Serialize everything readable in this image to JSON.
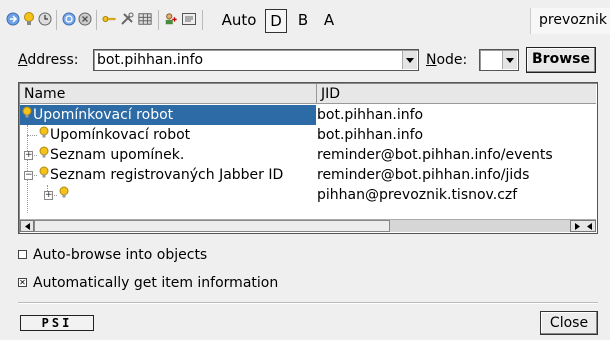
{
  "toolbar": {
    "icons": [
      "arrow-icon",
      "bulb-icon",
      "clock-icon",
      "refresh-icon",
      "stop-icon",
      "key-icon",
      "tools-icon",
      "grid-icon",
      "user-add-icon",
      "card-icon"
    ],
    "buttons": [
      {
        "label": "Auto",
        "active": false
      },
      {
        "label": "D",
        "active": true
      },
      {
        "label": "B",
        "active": false
      },
      {
        "label": "A",
        "active": false
      }
    ],
    "field_value": "prevoznik"
  },
  "address": {
    "label_u": "A",
    "label_rest": "ddress:",
    "value": "bot.pihhan.info",
    "node_label_u": "N",
    "node_label_rest": "ode:",
    "node_value": "",
    "browse_label": "Browse"
  },
  "tree": {
    "columns": [
      "Name",
      "JID"
    ],
    "rows": [
      {
        "name": "Upomínkovací robot",
        "jid": "bot.pihhan.info",
        "selected": true
      },
      {
        "name": "Upomínkovací robot",
        "jid": "bot.pihhan.info",
        "selected": false
      },
      {
        "name": "Seznam upomínek.",
        "jid": "reminder@bot.pihhan.info/events",
        "selected": false
      },
      {
        "name": "Seznam registrovaných Jabber ID",
        "jid": "reminder@bot.pihhan.info/jids",
        "selected": false
      },
      {
        "name": "",
        "jid": "pihhan@prevoznik.tisnov.czf",
        "selected": false
      }
    ]
  },
  "options": {
    "auto_browse": {
      "label": "Auto-browse into objects",
      "checked": false
    },
    "auto_info": {
      "label": "Automatically get item information",
      "checked": true
    }
  },
  "footer": {
    "logo_text": "PSI",
    "close_label": "Close"
  },
  "colors": {
    "selection": "#2d6ba6",
    "bulb": "#f4c21b"
  }
}
